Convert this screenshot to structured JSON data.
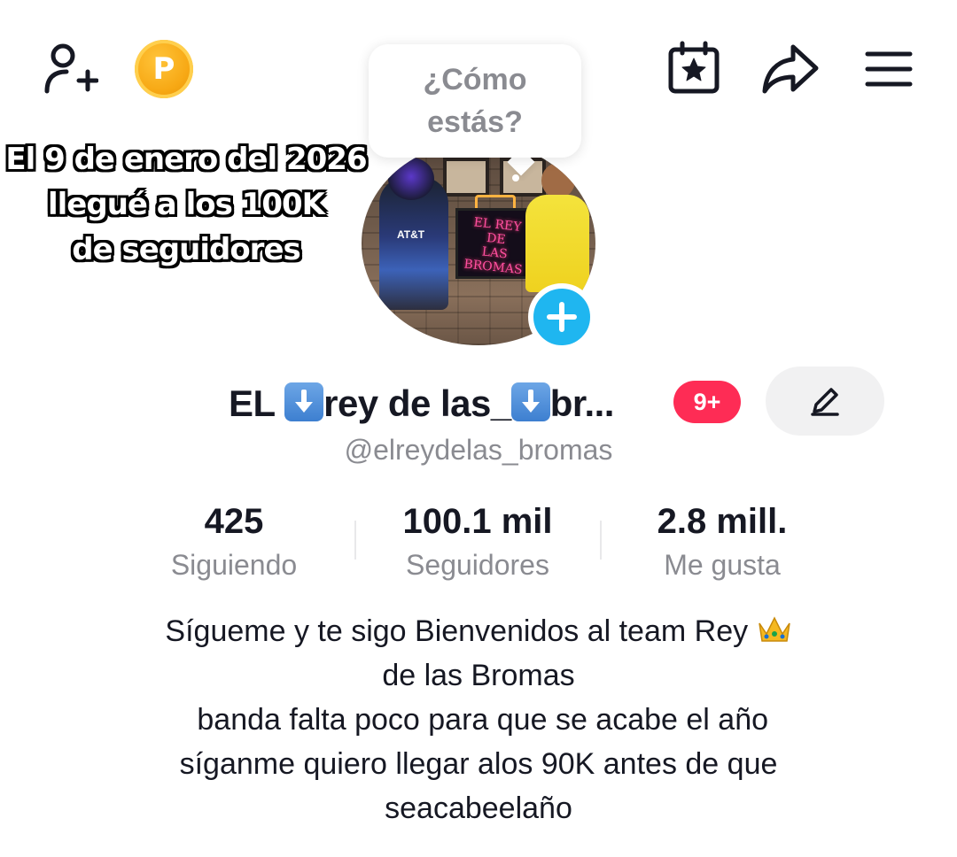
{
  "header": {
    "icons": [
      "add-friend-icon",
      "coin-icon",
      "calendar-star-icon",
      "share-icon",
      "menu-icon"
    ],
    "coin_letter": "P"
  },
  "overlay_text": {
    "line1": "El 9 de enero del 2026",
    "line2": "llegué a los 100K",
    "line3": "de seguidores"
  },
  "avatar": {
    "neon_sign_line1": "EL REY DE",
    "neon_sign_line2": "LAS BROMAS",
    "jersey_text": "AT&T"
  },
  "bubble": {
    "line1": "¿Cómo",
    "line2": "estás?"
  },
  "profile": {
    "name_part1": "EL ",
    "name_part2": "rey de las_",
    "name_part3": "br...",
    "notification_badge": "9+",
    "handle": "@elreydelas_bromas"
  },
  "stats": [
    {
      "value": "425",
      "label": "Siguiendo"
    },
    {
      "value": "100.1 mil",
      "label": "Seguidores"
    },
    {
      "value": "2.8 mill.",
      "label": "Me gusta"
    }
  ],
  "bio": {
    "line1": "Sígueme y te sigo Bienvenidos al team Rey ",
    "line2": "de las Bromas",
    "line3": " banda falta poco para que se acabe el año",
    "line4": "síganme quiero llegar alos 90K antes de que",
    "line5": "seacabeelaño"
  },
  "colors": {
    "accent_red": "#fe2c55",
    "accent_blue": "#1fb6f0",
    "text_primary": "#161823",
    "text_secondary": "#8a8b91",
    "coin": "#f7a814"
  }
}
